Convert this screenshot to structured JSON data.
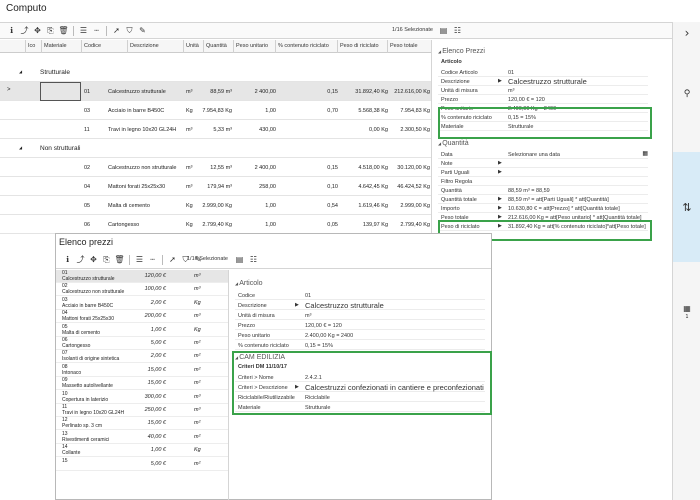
{
  "window": {
    "title": "Computo"
  },
  "toolbar": {
    "icons": [
      "info-icon",
      "export-icon",
      "move-icon",
      "copy-icon",
      "delete-icon",
      "list-icon",
      "dash-icon",
      "pointer-icon",
      "filter-icon",
      "edit-icon"
    ],
    "glyphs": [
      "ℹ",
      "⤴",
      "✥",
      "⎘",
      "🗑",
      "☰",
      "┄",
      "➚",
      "⛉",
      "✎"
    ],
    "status": "1/16 Selezionate"
  },
  "grid": {
    "headers": [
      "Ico",
      "Materiale",
      "Codice",
      "Descrizione",
      "Unità",
      "Quantità",
      "Peso unitario",
      "% contenuto riciclato",
      "Peso di riciclato",
      "Peso totale"
    ],
    "groups": [
      {
        "label": "Strutturale",
        "rows": [
          {
            "codice": "01",
            "descrizione": "Calcestruzzo strutturale",
            "unita": "m³",
            "quantita": "88,59 m³",
            "peso_unitario": "2 400,00",
            "perc": "0,15",
            "riciclato": "31.892,40 Kg",
            "totale": "212.616,00 Kg"
          },
          {
            "codice": "03",
            "descrizione": "Acciaio in barre B450C",
            "unita": "Kg",
            "quantita": "7.954,83 Kg",
            "peso_unitario": "1,00",
            "perc": "0,70",
            "riciclato": "5.568,38 Kg",
            "totale": "7.954,83 Kg"
          },
          {
            "codice": "11",
            "descrizione": "Travi in legno 10x20 GL24H",
            "unita": "m³",
            "quantita": "5,33 m³",
            "peso_unitario": "430,00",
            "perc": "",
            "riciclato": "0,00 Kg",
            "totale": "2.300,50 Kg"
          }
        ]
      },
      {
        "label": "Non strutturali",
        "rows": [
          {
            "codice": "02",
            "descrizione": "Calcestruzzo non strutturale",
            "unita": "m³",
            "quantita": "12,55 m³",
            "peso_unitario": "2 400,00",
            "perc": "0,15",
            "riciclato": "4.518,00 Kg",
            "totale": "30.120,00 Kg"
          },
          {
            "codice": "04",
            "descrizione": "Mattoni forati 25x25x30",
            "unita": "m³",
            "quantita": "179,94 m³",
            "peso_unitario": "258,00",
            "perc": "0,10",
            "riciclato": "4.642,45 Kg",
            "totale": "46.424,52 Kg"
          },
          {
            "codice": "05",
            "descrizione": "Malta di cemento",
            "unita": "Kg",
            "quantita": "2.999,00 Kg",
            "peso_unitario": "1,00",
            "perc": "0,54",
            "riciclato": "1.619,46 Kg",
            "totale": "2.999,00 Kg"
          },
          {
            "codice": "06",
            "descrizione": "Cartongesso",
            "unita": "Kg",
            "quantita": "2.799,40 Kg",
            "peso_unitario": "1,00",
            "perc": "0,05",
            "riciclato": "139,97 Kg",
            "totale": "2.799,40 Kg"
          }
        ]
      }
    ]
  },
  "props": {
    "elenco_prezzi": {
      "title": "Elenco Prezzi",
      "subtitle": "Articolo",
      "rows": [
        {
          "label": "Codice Articolo",
          "value": "01"
        },
        {
          "label": "Descrizione",
          "value": "Calcestruzzo strutturale"
        },
        {
          "label": "Unità di misura",
          "value": "m³"
        },
        {
          "label": "Prezzo",
          "value": "120,00 € = 120"
        },
        {
          "label": "Peso unitario",
          "value": "2.400,00 Kg = 2400"
        },
        {
          "label": "% contenuto riciclato",
          "value": "0,15 = 15%"
        },
        {
          "label": "Materiale",
          "value": "Strutturale"
        }
      ]
    },
    "quantita": {
      "title": "Quantità",
      "rows": [
        {
          "label": "Data",
          "value": "Selezionare una data"
        },
        {
          "label": "Note",
          "value": ""
        },
        {
          "label": "Parti Uguali",
          "value": ""
        },
        {
          "label": "Filtro Regola",
          "value": ""
        },
        {
          "label": "Quantità",
          "value": "88,59 m³ = 88,59"
        },
        {
          "label": "Quantità totale",
          "value": "88,59 m³ = att[Parti Uguali] * att[Quantità]"
        },
        {
          "label": "Importo",
          "value": "10.630,80 € = att[Prezzo] * att[Quantità totale]"
        },
        {
          "label": "Peso totale",
          "value": "212.616,00 Kg = att[Peso unitario] * att[Quantità totale]"
        },
        {
          "label": "Peso di riciclato",
          "value": "31.892,40 Kg = att[% contenuto riciclato]*att[Peso totale]"
        }
      ]
    }
  },
  "overlay": {
    "title": "Elenco prezzi",
    "status": "1/16 Selezionate",
    "items": [
      {
        "code": "01",
        "desc": "Calcestruzzo strutturale",
        "price": "120,00 €",
        "unit": "m³"
      },
      {
        "code": "02",
        "desc": "Calcestruzzo non strutturale",
        "price": "100,00 €",
        "unit": "m³"
      },
      {
        "code": "03",
        "desc": "Acciaio in barre B450C",
        "price": "2,00 €",
        "unit": "Kg"
      },
      {
        "code": "04",
        "desc": "Mattoni forati 25x25x30",
        "price": "200,00 €",
        "unit": "m³"
      },
      {
        "code": "05",
        "desc": "Malta di cemento",
        "price": "1,00 €",
        "unit": "Kg"
      },
      {
        "code": "06",
        "desc": "Cartongesso",
        "price": "5,00 €",
        "unit": "m²"
      },
      {
        "code": "07",
        "desc": "Isolanti di origine sintetica",
        "price": "2,00 €",
        "unit": "m²"
      },
      {
        "code": "08",
        "desc": "Intonaco",
        "price": "15,00 €",
        "unit": "m²"
      },
      {
        "code": "09",
        "desc": "Massetto autolivellante",
        "price": "15,00 €",
        "unit": "m²"
      },
      {
        "code": "10",
        "desc": "Copertura in laterizio",
        "price": "300,00 €",
        "unit": "m³"
      },
      {
        "code": "11",
        "desc": "Travi in legno 10x20 GL24H",
        "price": "250,00 €",
        "unit": "m³"
      },
      {
        "code": "12",
        "desc": "Perlinato sp. 3 cm",
        "price": "15,00 €",
        "unit": "m²"
      },
      {
        "code": "13",
        "desc": "Rivestimenti ceramici",
        "price": "40,00 €",
        "unit": "m²"
      },
      {
        "code": "14",
        "desc": "Collante",
        "price": "1,00 €",
        "unit": "Kg"
      },
      {
        "code": "15",
        "desc": "",
        "price": "5,00 €",
        "unit": "m²"
      }
    ],
    "articolo": {
      "title": "Articolo",
      "rows": [
        {
          "label": "Codice",
          "value": "01"
        },
        {
          "label": "Descrizione",
          "value": "Calcestruzzo strutturale"
        },
        {
          "label": "Unità di misura",
          "value": "m³"
        },
        {
          "label": "Prezzo",
          "value": "120,00 € = 120"
        },
        {
          "label": "Peso unitario",
          "value": "2.400,00 Kg = 2400"
        },
        {
          "label": "% contenuto riciclato",
          "value": "0,15 = 15%"
        }
      ]
    },
    "cam": {
      "title": "CAM EDILIZIA",
      "subtitle": "Criteri DM 11/10/17",
      "rows": [
        {
          "label": "Criteri > Nome",
          "value": "2.4.2.1"
        },
        {
          "label": "Criteri > Descrizione",
          "value": "Calcestruzzi confezionati in cantiere e preconfezionati"
        },
        {
          "label": "Riciclabile/Riutilizzabile",
          "value": "Riciclabile"
        },
        {
          "label": "Materiale",
          "value": "Strutturale"
        }
      ]
    }
  },
  "rail": {
    "chevron": "›",
    "tool1": "⚲",
    "toggle": "⇅",
    "tool2": "▦",
    "tool2_count": "1"
  },
  "colors": {
    "highlight": "#3aa24a",
    "selected_row": "#e6e6e6",
    "rail_highlight": "#d8ebf7"
  }
}
